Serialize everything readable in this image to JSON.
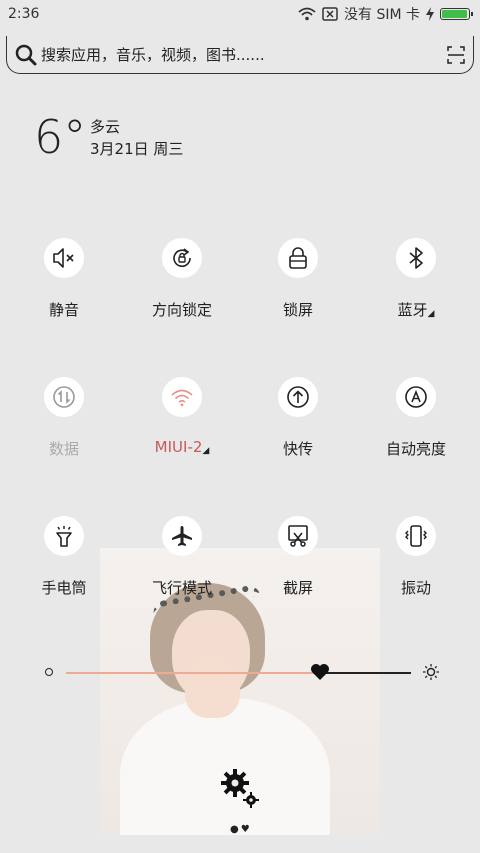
{
  "status": {
    "time": "2:36",
    "sim_text": "没有 SIM 卡",
    "battery_level": 0.95,
    "battery_color": "#3fbf4a"
  },
  "search": {
    "placeholder": "搜索应用，音乐，视频，图书......",
    "left_icon": "search-icon",
    "right_icon": "scan-icon"
  },
  "weather": {
    "temperature": "6°",
    "condition": "多云",
    "date": "3月21日 周三"
  },
  "toggles": [
    {
      "label": "静音",
      "icon": "mute-icon",
      "state": "normal"
    },
    {
      "label": "方向锁定",
      "icon": "rotation-lock-icon",
      "state": "normal"
    },
    {
      "label": "锁屏",
      "icon": "lock-icon",
      "state": "normal"
    },
    {
      "label": "蓝牙",
      "icon": "bluetooth-icon",
      "state": "normal",
      "has_menu": true
    },
    {
      "label": "数据",
      "icon": "data-icon",
      "state": "disabled"
    },
    {
      "label": "MIUI-2",
      "icon": "wifi-icon",
      "state": "active",
      "has_menu": true
    },
    {
      "label": "快传",
      "icon": "transfer-icon",
      "state": "normal"
    },
    {
      "label": "自动亮度",
      "icon": "auto-brightness-icon",
      "state": "normal"
    },
    {
      "label": "手电筒",
      "icon": "flashlight-icon",
      "state": "normal"
    },
    {
      "label": "飞行模式",
      "icon": "airplane-icon",
      "state": "normal"
    },
    {
      "label": "截屏",
      "icon": "screenshot-icon",
      "state": "normal"
    },
    {
      "label": "振动",
      "icon": "vibrate-icon",
      "state": "normal"
    }
  ],
  "colors": {
    "active": "#c65a5a",
    "disabled": "#aaaaaa",
    "slider_fill": "#f0a995"
  },
  "brightness": {
    "level": 0.7
  }
}
